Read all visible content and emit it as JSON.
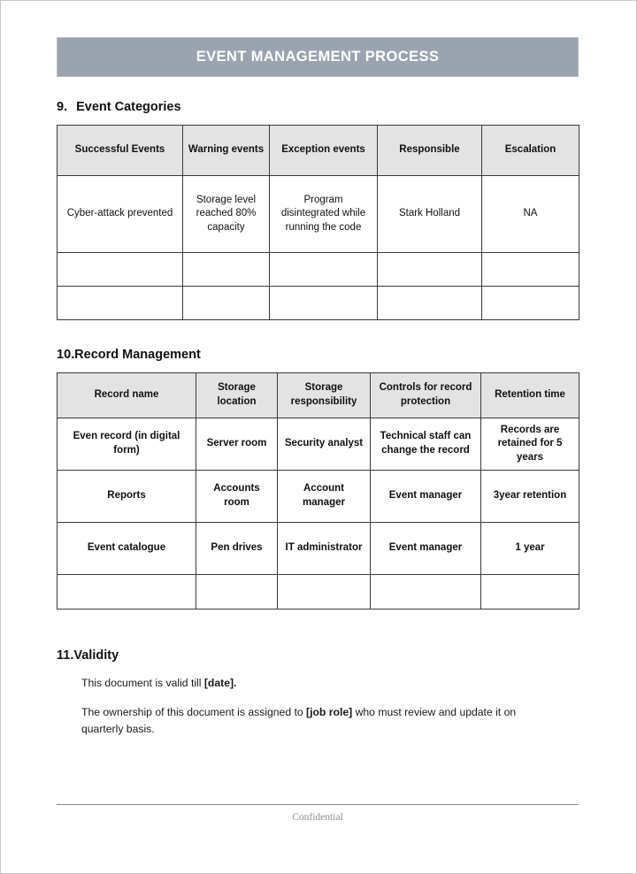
{
  "document": {
    "banner_title": "EVENT MANAGEMENT PROCESS",
    "banner_color": "#9aa3ae",
    "table_header_color": "#e3e3e3"
  },
  "sections": {
    "event_categories": {
      "number": "9.",
      "title": "Event Categories",
      "columns": [
        "Successful Events",
        "Warning events",
        "Exception events",
        "Responsible",
        "Escalation"
      ],
      "rows": [
        [
          "Cyber-attack prevented",
          "Storage level reached 80% capacity",
          "Program disintegrated while running the code",
          "Stark Holland",
          "NA"
        ],
        [
          "",
          "",
          "",
          "",
          ""
        ],
        [
          "",
          "",
          "",
          "",
          ""
        ]
      ]
    },
    "record_management": {
      "number": "10.",
      "title": "Record Management",
      "columns": [
        "Record name",
        "Storage location",
        "Storage responsibility",
        "Controls for record protection",
        "Retention time"
      ],
      "rows": [
        [
          "Even record (in digital form)",
          "Server room",
          "Security analyst",
          "Technical staff can change the record",
          "Records are retained for 5 years"
        ],
        [
          "Reports",
          "Accounts room",
          "Account manager",
          "Event manager",
          "3year retention"
        ],
        [
          "Event catalogue",
          "Pen drives",
          "IT administrator",
          "Event manager",
          "1 year"
        ],
        [
          "",
          "",
          "",
          "",
          ""
        ]
      ]
    },
    "validity": {
      "number": "11.",
      "title": "Validity",
      "paragraph_1_prefix": "This document is valid till ",
      "paragraph_1_bold": "[date].",
      "paragraph_1_suffix": "",
      "paragraph_2_prefix": "The ownership of this document is assigned to ",
      "paragraph_2_bold": "[job role]",
      "paragraph_2_suffix": " who must review and update it on quarterly basis."
    }
  },
  "footer": {
    "text": "Confidential"
  }
}
